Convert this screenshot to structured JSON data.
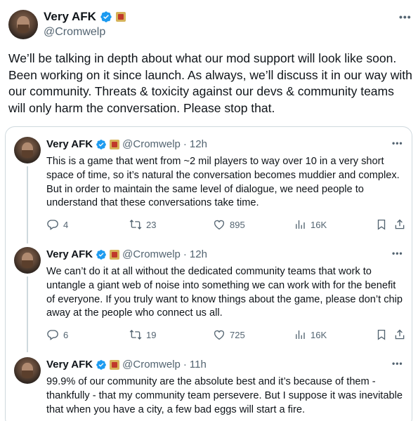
{
  "main": {
    "name": "Very AFK",
    "handle": "@Cromwelp",
    "text": "We’ll be talking in depth about what our mod support will look like soon. Been working on it since launch. As always, we’ll discuss it in our way with our community. Threats & toxicity against our devs & community teams will only harm the conversation. Please stop that."
  },
  "replies": [
    {
      "name": "Very AFK",
      "handle": "@Cromwelp",
      "time": "12h",
      "text": "This is a game that went from ~2 mil players to way over 10 in a very short space of time, so it’s natural the conversation becomes muddier and complex. But in order to maintain the same level of dialogue, we need people to understand that these conversations take time.",
      "replies": "4",
      "reposts": "23",
      "likes": "895",
      "views": "16K"
    },
    {
      "name": "Very AFK",
      "handle": "@Cromwelp",
      "time": "12h",
      "text": "We can’t do it at all without the dedicated community teams that work to untangle a giant web of noise into something we can work with for the benefit of everyone. If you truly want to know things about the game, please don’t chip away at the people who connect us all.",
      "replies": "6",
      "reposts": "19",
      "likes": "725",
      "views": "16K"
    },
    {
      "name": "Very AFK",
      "handle": "@Cromwelp",
      "time": "11h",
      "text": "99.9% of our community are the absolute best and it’s because of them - thankfully - that my community team persevere. But I suppose it was inevitable that when you have a city, a few bad eggs will start a fire."
    }
  ],
  "icons": {
    "verified": "verified-badge-icon",
    "flair": "flair-badge-icon",
    "more": "more-icon",
    "reply": "reply-icon",
    "repost": "repost-icon",
    "like": "like-icon",
    "views": "views-icon",
    "bookmark": "bookmark-icon",
    "share": "share-icon"
  },
  "colors": {
    "verified": "#1d9bf0",
    "text": "#0f1419",
    "secondary": "#536471",
    "border": "#cfd9de"
  }
}
